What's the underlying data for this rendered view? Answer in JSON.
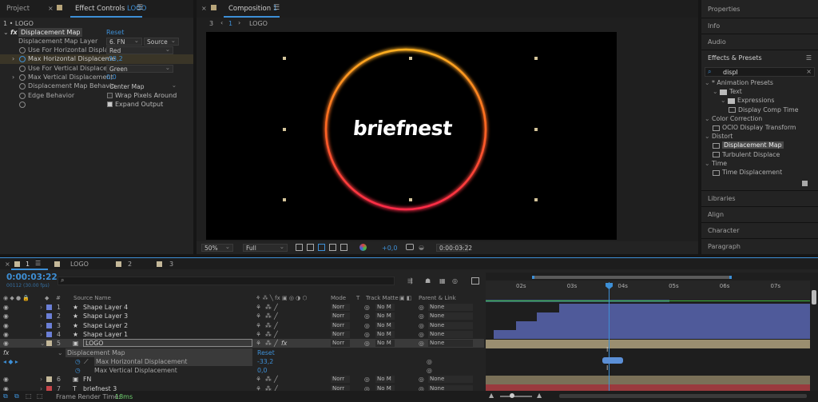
{
  "project_panel": {
    "project_tab": "Project"
  },
  "effect_controls": {
    "tab_label": "Effect Controls",
    "tab_layer": "LOGO",
    "breadcrumb": "1 • LOGO",
    "effect_name": "Displacement Map",
    "reset": "Reset",
    "rows": [
      {
        "label": "Displacement Map Layer",
        "value1": "6. FN",
        "value2": "Source"
      },
      {
        "label": "Use For Horizontal Displace",
        "value": "Red"
      },
      {
        "label": "Max Horizontal Displaceme",
        "value": "-33,2"
      },
      {
        "label": "Use For Vertical Displaceme",
        "value": "Green"
      },
      {
        "label": "Max Vertical Displacement",
        "value": "0,0"
      },
      {
        "label": "Displacement Map Behavio",
        "value": "Center Map"
      },
      {
        "label": "Edge Behavior",
        "check_label": "Wrap Pixels Around"
      },
      {
        "label": "",
        "check_label": "Expand Output"
      }
    ]
  },
  "composition": {
    "tab_label": "Composition",
    "tab_num": "1",
    "nav_num": "3",
    "nav_current": "1",
    "nav_name": "LOGO",
    "logo_text": "briefnest",
    "zoom": "50%",
    "resolution": "Full",
    "exposure": "+0,0",
    "timecode": "0:00:03:22"
  },
  "right_panels": {
    "properties": "Properties",
    "info": "Info",
    "audio": "Audio",
    "effects_presets": "Effects & Presets",
    "search_value": "displ",
    "tree": [
      {
        "label": "* Animation Presets",
        "indent": 0,
        "kind": "group"
      },
      {
        "label": "Text",
        "indent": 1,
        "kind": "folder"
      },
      {
        "label": "Expressions",
        "indent": 2,
        "kind": "folder"
      },
      {
        "label": "Display Comp Time",
        "indent": 3,
        "kind": "preset"
      },
      {
        "label": "Color Correction",
        "indent": 0,
        "kind": "group"
      },
      {
        "label": "OCIO Display Transform",
        "indent": 1,
        "kind": "effect"
      },
      {
        "label": "Distort",
        "indent": 0,
        "kind": "group"
      },
      {
        "label": "Displacement Map",
        "indent": 1,
        "kind": "effect",
        "selected": true
      },
      {
        "label": "Turbulent Displace",
        "indent": 1,
        "kind": "effect"
      },
      {
        "label": "Time",
        "indent": 0,
        "kind": "group"
      },
      {
        "label": "Time Displacement",
        "indent": 1,
        "kind": "effect"
      }
    ],
    "libraries": "Libraries",
    "align": "Align",
    "character": "Character",
    "paragraph": "Paragraph"
  },
  "timeline": {
    "tabs": [
      {
        "num": "1",
        "name": "LOGO"
      },
      {
        "num": "2",
        "name": ""
      },
      {
        "num": "3",
        "name": ""
      }
    ],
    "timecode": "0:00:03:22",
    "frames": "00112 (30.00 fps)",
    "columns": {
      "num": "#",
      "source": "Source Name",
      "mode": "Mode",
      "t": "T",
      "track_matte": "Track Matte",
      "parent": "Parent & Link"
    },
    "layers": [
      {
        "num": "1",
        "name": "Shape Layer 4",
        "type": "shape",
        "mode": "Norr",
        "matte": "No M",
        "parent": "None",
        "color": "#6b7fd6"
      },
      {
        "num": "2",
        "name": "Shape Layer 3",
        "type": "shape",
        "mode": "Norr",
        "matte": "No M",
        "parent": "None",
        "color": "#6b7fd6"
      },
      {
        "num": "3",
        "name": "Shape Layer 2",
        "type": "shape",
        "mode": "Norr",
        "matte": "No M",
        "parent": "None",
        "color": "#6b7fd6"
      },
      {
        "num": "4",
        "name": "Shape Layer 1",
        "type": "shape",
        "mode": "Norr",
        "matte": "No M",
        "parent": "None",
        "color": "#6b7fd6"
      },
      {
        "num": "5",
        "name": "LOGO",
        "type": "precomp",
        "mode": "Norr",
        "matte": "No M",
        "parent": "None",
        "color": "#c4b899"
      },
      {
        "num": "6",
        "name": "FN",
        "type": "precomp",
        "mode": "Norr",
        "matte": "No M",
        "parent": "None",
        "color": "#c4b899"
      },
      {
        "num": "7",
        "name": "briefnest 3",
        "type": "text",
        "mode": "Norr",
        "matte": "No M",
        "parent": "None",
        "color": "#c8464a"
      }
    ],
    "effect_row": {
      "name": "Displacement Map",
      "reset": "Reset"
    },
    "prop_rows": [
      {
        "name": "Max Horizontal Displacement",
        "value": "-33,2"
      },
      {
        "name": "Max Vertical Displacement",
        "value": "0,0"
      }
    ],
    "ruler": [
      "02s",
      "03s",
      "04s",
      "05s",
      "06s",
      "07s"
    ],
    "render_time_label": "Frame Render Time:",
    "render_time_value": "18ms"
  }
}
